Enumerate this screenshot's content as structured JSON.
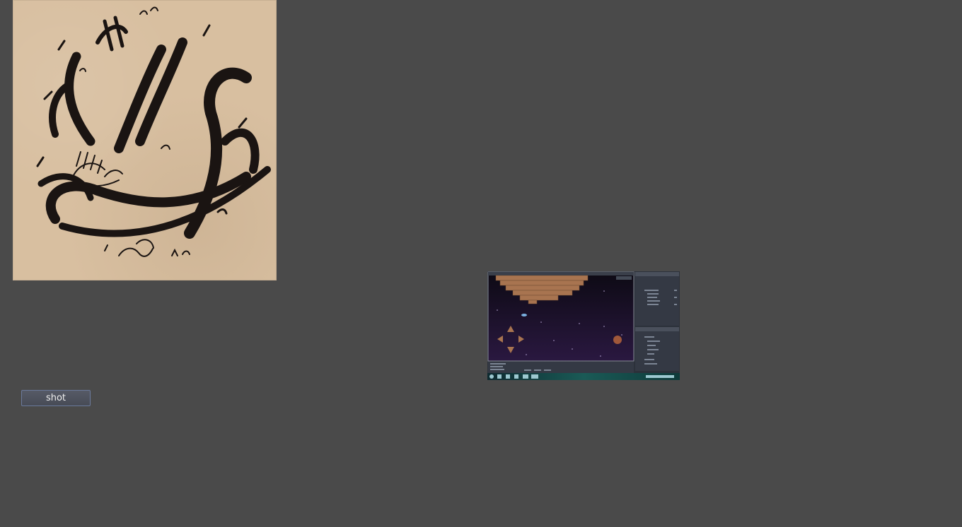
{
  "button": {
    "label": "shot"
  },
  "images": {
    "calligraphy": {
      "kind": "arabic-calligraphy-artwork",
      "background_color": "#d8bfa0",
      "ink_color": "#1a1412"
    },
    "game_screenshot": {
      "kind": "game-editor-screenshot",
      "sky_color": "#120c1e",
      "brick_color": "#a87450"
    }
  },
  "colors": {
    "page_background": "#4a4a4a",
    "button_border": "#6b7a9c"
  }
}
